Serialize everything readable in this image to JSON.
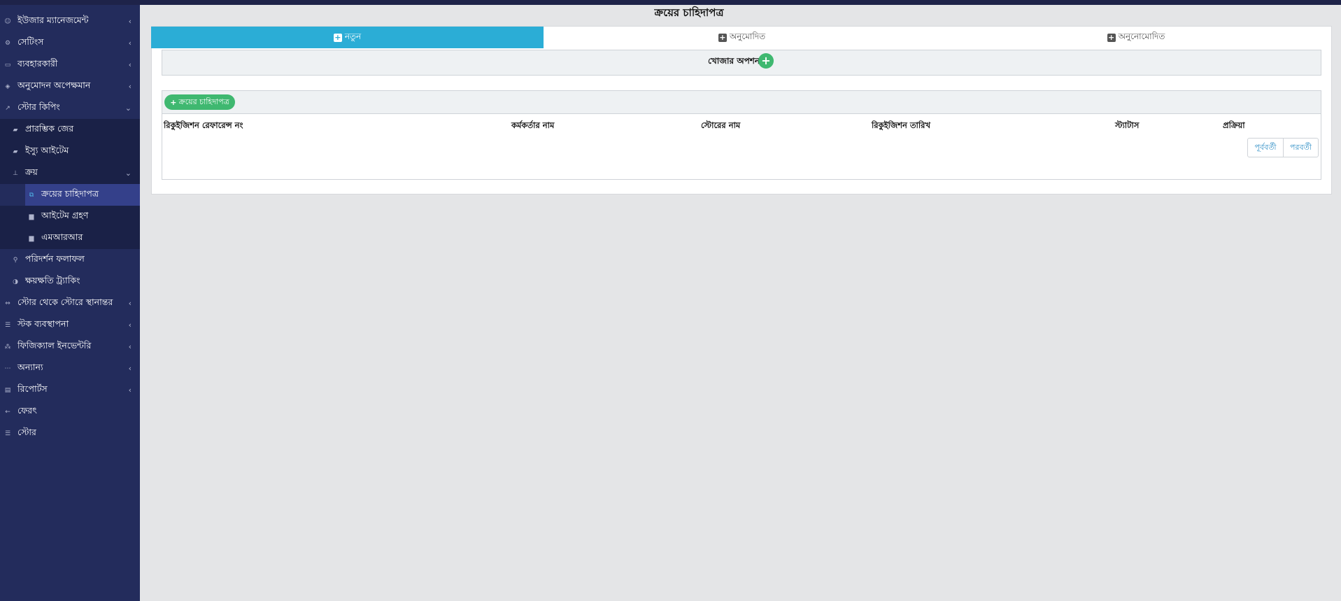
{
  "sidebar": {
    "items": [
      {
        "label": "ইউজার ম্যানেজমেন্ট",
        "icon": "user-icon",
        "arrow": "‹"
      },
      {
        "label": "সেটিংস",
        "icon": "gear-icon",
        "arrow": "‹"
      },
      {
        "label": "ব্যবহারকারী",
        "icon": "cart-icon",
        "arrow": "‹"
      },
      {
        "label": "অনুমোদন অপেক্ষমান",
        "icon": "box-icon",
        "arrow": "‹"
      },
      {
        "label": "স্টোর কিপিং",
        "icon": "chart-line-icon",
        "arrow": "⌄"
      },
      {
        "label": "প্রারম্ভিক জের",
        "icon": "folder-icon"
      },
      {
        "label": "ইস্যু আইটেম",
        "icon": "folder-icon"
      },
      {
        "label": "ক্রয়",
        "icon": "sitemap-icon",
        "arrow": "⌄"
      },
      {
        "label": "ক্রয়ের চাহিদাপত্র",
        "icon": "object-group-icon"
      },
      {
        "label": "আইটেম গ্রহণ",
        "icon": "briefcase-icon"
      },
      {
        "label": "এমআরআর",
        "icon": "briefcase-icon"
      },
      {
        "label": "পরিদর্শন ফলাফল",
        "icon": "search-icon"
      },
      {
        "label": "ক্ষয়ক্ষতি ট্র্যাকিং",
        "icon": "adjust-icon"
      },
      {
        "label": "স্টোর থেকে স্টোরে স্থানান্তর",
        "icon": "exchange-icon",
        "arrow": "‹"
      },
      {
        "label": "স্টক ব্যবস্থাপনা",
        "icon": "sliders-icon",
        "arrow": "‹"
      },
      {
        "label": "ফিজিক্যাল ইনভেন্টরি",
        "icon": "cubes-icon",
        "arrow": "‹"
      },
      {
        "label": "অন্যান্য",
        "icon": "ellipsis-icon",
        "arrow": "‹"
      },
      {
        "label": "রিপোর্টস",
        "icon": "book-icon",
        "arrow": "‹"
      },
      {
        "label": "ফেরৎ",
        "icon": "arrow-left-icon"
      },
      {
        "label": "স্টোর",
        "icon": "sliders-icon"
      }
    ]
  },
  "page": {
    "title": "ক্রয়ের চাহিদাপত্র"
  },
  "tabs": [
    {
      "label": "নতুন",
      "active": true
    },
    {
      "label": "অনুমোদিত",
      "active": false
    },
    {
      "label": "অনুনোমোদিত",
      "active": false
    }
  ],
  "search": {
    "label": "খোজার অপশন",
    "toggle_symbol": "+"
  },
  "table": {
    "add_button_label": "ক্রয়ের চাহিদাপত্র",
    "add_button_symbol": "+",
    "columns": [
      "রিকুইজিশন রেফারেন্স নং",
      "কর্মকর্তার নাম",
      "স্টোরের নাম",
      "রিকুইজিশন তারিখ",
      "স্ট্যাটাস",
      "প্রক্রিয়া"
    ],
    "rows": []
  },
  "pagination": {
    "prev_label": "পূর্ববর্তী",
    "next_label": "পরবর্তী"
  },
  "colors": {
    "sidebar_bg": "#232c5c",
    "sidebar_dark": "#1a2147",
    "sidebar_active": "#34408a",
    "tab_active": "#2badd6",
    "green": "#3fb870",
    "link": "#2a8cc4"
  }
}
